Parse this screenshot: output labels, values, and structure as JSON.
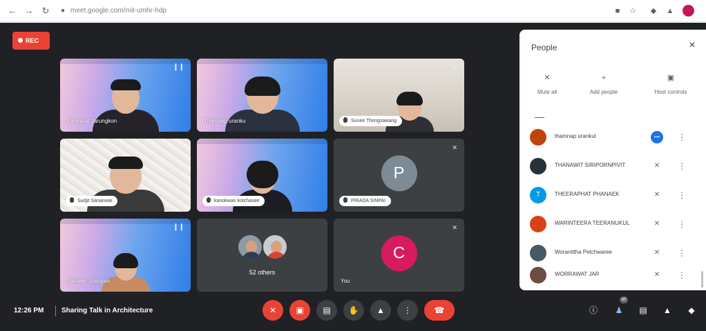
{
  "browser": {
    "back_icon": "back-arrow-icon",
    "forward_icon": "forward-arrow-icon",
    "reload_icon": "reload-icon",
    "url": "meet.google.com/mit-umhr-hdp",
    "profile_color": "#c2185b"
  },
  "recording": {
    "label": "REC",
    "color": "#ea4335"
  },
  "tiles": [
    {
      "name": "Pannarat Jarungkon",
      "style": "slide",
      "label_style": "plain",
      "indicator": "speaking"
    },
    {
      "name": "Thamnap uranku",
      "style": "slide",
      "label_style": "plain",
      "indicator": "none"
    },
    {
      "name": "Sunee Thongsawang",
      "style": "room",
      "label_style": "pill",
      "indicator": "muted"
    },
    {
      "name": "Sudjit Sananwai",
      "style": "sketch",
      "label_style": "pill",
      "indicator": "none"
    },
    {
      "name": "kanokwan kotchasee",
      "style": "slide",
      "label_style": "pill",
      "indicator": "none"
    },
    {
      "name": "PIRADA SINPAI",
      "style": "dark",
      "label_style": "pill",
      "indicator": "muted",
      "avatar_letter": "P",
      "avatar_color": "#7c8b96"
    },
    {
      "name": "Saowan Srisupan",
      "style": "slide",
      "label_style": "plain",
      "indicator": "speaking"
    },
    {
      "name": "52 others",
      "style": "others",
      "label_style": "center",
      "indicator": "none"
    },
    {
      "name": "You",
      "style": "dark",
      "label_style": "plain",
      "indicator": "muted",
      "avatar_letter": "C",
      "avatar_color": "#d81b60"
    }
  ],
  "bottom_bar": {
    "time": "12:26 PM",
    "meeting_title": "Sharing Talk in Architecture",
    "controls": [
      {
        "name": "mic-off-button",
        "icon": "mic-off-icon",
        "state": "off"
      },
      {
        "name": "camera-off-button",
        "icon": "camera-off-icon",
        "state": "off"
      },
      {
        "name": "captions-button",
        "icon": "captions-icon",
        "state": "neutral"
      },
      {
        "name": "raise-hand-button",
        "icon": "hand-icon",
        "state": "neutral"
      },
      {
        "name": "present-button",
        "icon": "present-icon",
        "state": "neutral"
      },
      {
        "name": "more-options-button",
        "icon": "more-vert-icon",
        "state": "neutral"
      },
      {
        "name": "leave-call-button",
        "icon": "call-end-icon",
        "state": "leave"
      }
    ],
    "right_icons": [
      {
        "name": "meeting-details-button",
        "icon": "info-icon",
        "active": false
      },
      {
        "name": "people-button",
        "icon": "people-icon",
        "active": true
      },
      {
        "name": "chat-button",
        "icon": "chat-icon",
        "active": false
      },
      {
        "name": "activities-button",
        "icon": "activities-icon",
        "active": false
      },
      {
        "name": "host-controls-button",
        "icon": "shield-icon",
        "active": false
      }
    ],
    "people_badge": "60"
  },
  "people_panel": {
    "title": "People",
    "actions": [
      {
        "name": "mute-all-button",
        "label": "Mute all",
        "icon": "mic-off-icon"
      },
      {
        "name": "add-people-button",
        "label": "Add people",
        "icon": "add-person-icon"
      },
      {
        "name": "host-controls-panel-button",
        "label": "Host controls",
        "icon": "toggle-icon"
      }
    ],
    "participants": [
      {
        "name": "thamnap urankul",
        "avatar": "photo",
        "avatar_color": "#c1440e",
        "status": "talking"
      },
      {
        "name": "THANAWIT SIRIPORNPIVIT",
        "avatar": "photo",
        "avatar_color": "#263238",
        "status": "muted"
      },
      {
        "name": "THEERAPHAT PHANAEK",
        "avatar": "T",
        "avatar_color": "#039be5",
        "status": "muted"
      },
      {
        "name": "WARINTEERA TEERANUKUL",
        "avatar": "photo",
        "avatar_color": "#d84315",
        "status": "muted"
      },
      {
        "name": "Woranittha Petchwaree",
        "avatar": "photo",
        "avatar_color": "#455a64",
        "status": "muted"
      },
      {
        "name": "WORRAWAT JAR",
        "avatar": "photo",
        "avatar_color": "#6d4c41",
        "status": "muted"
      }
    ]
  }
}
